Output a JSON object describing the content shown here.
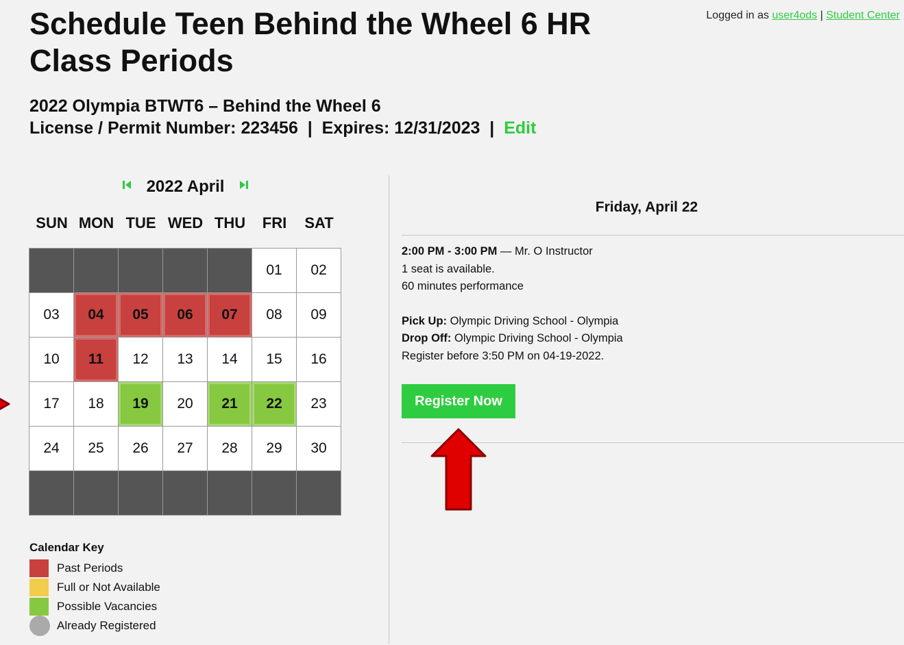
{
  "header": {
    "title": "Schedule Teen Behind the Wheel 6 HR Class Periods",
    "login_prefix": "Logged in as",
    "username": "user4ods",
    "separator": "|",
    "student_center": "Student Center"
  },
  "course": {
    "name": "2022 Olympia BTWT6 – Behind the Wheel 6",
    "license_label": "License / Permit Number:",
    "license_number": "223456",
    "expires_label": "Expires:",
    "expires": "12/31/2023",
    "edit": "Edit"
  },
  "calendar": {
    "month_label": "2022 April",
    "prev_icon": "first-page-icon",
    "next_icon": "last-page-icon",
    "weekdays": [
      "SUN",
      "MON",
      "TUE",
      "WED",
      "THU",
      "FRI",
      "SAT"
    ],
    "weeks": [
      [
        {
          "d": "",
          "s": "empty"
        },
        {
          "d": "",
          "s": "empty"
        },
        {
          "d": "",
          "s": "empty"
        },
        {
          "d": "",
          "s": "empty"
        },
        {
          "d": "",
          "s": "empty"
        },
        {
          "d": "01",
          "s": ""
        },
        {
          "d": "02",
          "s": ""
        }
      ],
      [
        {
          "d": "03",
          "s": ""
        },
        {
          "d": "04",
          "s": "past"
        },
        {
          "d": "05",
          "s": "past"
        },
        {
          "d": "06",
          "s": "past"
        },
        {
          "d": "07",
          "s": "past"
        },
        {
          "d": "08",
          "s": ""
        },
        {
          "d": "09",
          "s": ""
        }
      ],
      [
        {
          "d": "10",
          "s": ""
        },
        {
          "d": "11",
          "s": "past"
        },
        {
          "d": "12",
          "s": ""
        },
        {
          "d": "13",
          "s": ""
        },
        {
          "d": "14",
          "s": ""
        },
        {
          "d": "15",
          "s": ""
        },
        {
          "d": "16",
          "s": ""
        }
      ],
      [
        {
          "d": "17",
          "s": ""
        },
        {
          "d": "18",
          "s": ""
        },
        {
          "d": "19",
          "s": "open"
        },
        {
          "d": "20",
          "s": ""
        },
        {
          "d": "21",
          "s": "open"
        },
        {
          "d": "22",
          "s": "open"
        },
        {
          "d": "23",
          "s": ""
        }
      ],
      [
        {
          "d": "24",
          "s": ""
        },
        {
          "d": "25",
          "s": ""
        },
        {
          "d": "26",
          "s": ""
        },
        {
          "d": "27",
          "s": ""
        },
        {
          "d": "28",
          "s": ""
        },
        {
          "d": "29",
          "s": ""
        },
        {
          "d": "30",
          "s": ""
        }
      ],
      [
        {
          "d": "",
          "s": "empty"
        },
        {
          "d": "",
          "s": "empty"
        },
        {
          "d": "",
          "s": "empty"
        },
        {
          "d": "",
          "s": "empty"
        },
        {
          "d": "",
          "s": "empty"
        },
        {
          "d": "",
          "s": "empty"
        },
        {
          "d": "",
          "s": "empty"
        }
      ]
    ]
  },
  "calendar_key": {
    "title": "Calendar Key",
    "items": [
      {
        "label": "Past Periods",
        "color": "#c8413f",
        "shape": "square"
      },
      {
        "label": "Full or Not Available",
        "color": "#f2cd4c",
        "shape": "square"
      },
      {
        "label": "Possible Vacancies",
        "color": "#86c940",
        "shape": "square"
      },
      {
        "label": "Already Registered",
        "color": "#aaaaaa",
        "shape": "circle"
      }
    ]
  },
  "selected_day": {
    "title": "Friday, April 22",
    "time": "2:00 PM - 3:00 PM",
    "instructor": " — Mr. O Instructor",
    "seats": "1 seat is available.",
    "duration": "60 minutes performance",
    "pickup_label": "Pick Up:",
    "pickup": " Olympic Driving School - Olympia",
    "dropoff_label": "Drop Off:",
    "dropoff": " Olympic Driving School - Olympia",
    "deadline": "Register before 3:50 PM on 04-19-2022.",
    "register_button": "Register Now"
  },
  "colors": {
    "accent_green": "#2ecc40",
    "past": "#c8413f",
    "vacancy": "#86c940",
    "unavailable": "#f2cd4c",
    "annotation_arrow": "#e00000"
  }
}
